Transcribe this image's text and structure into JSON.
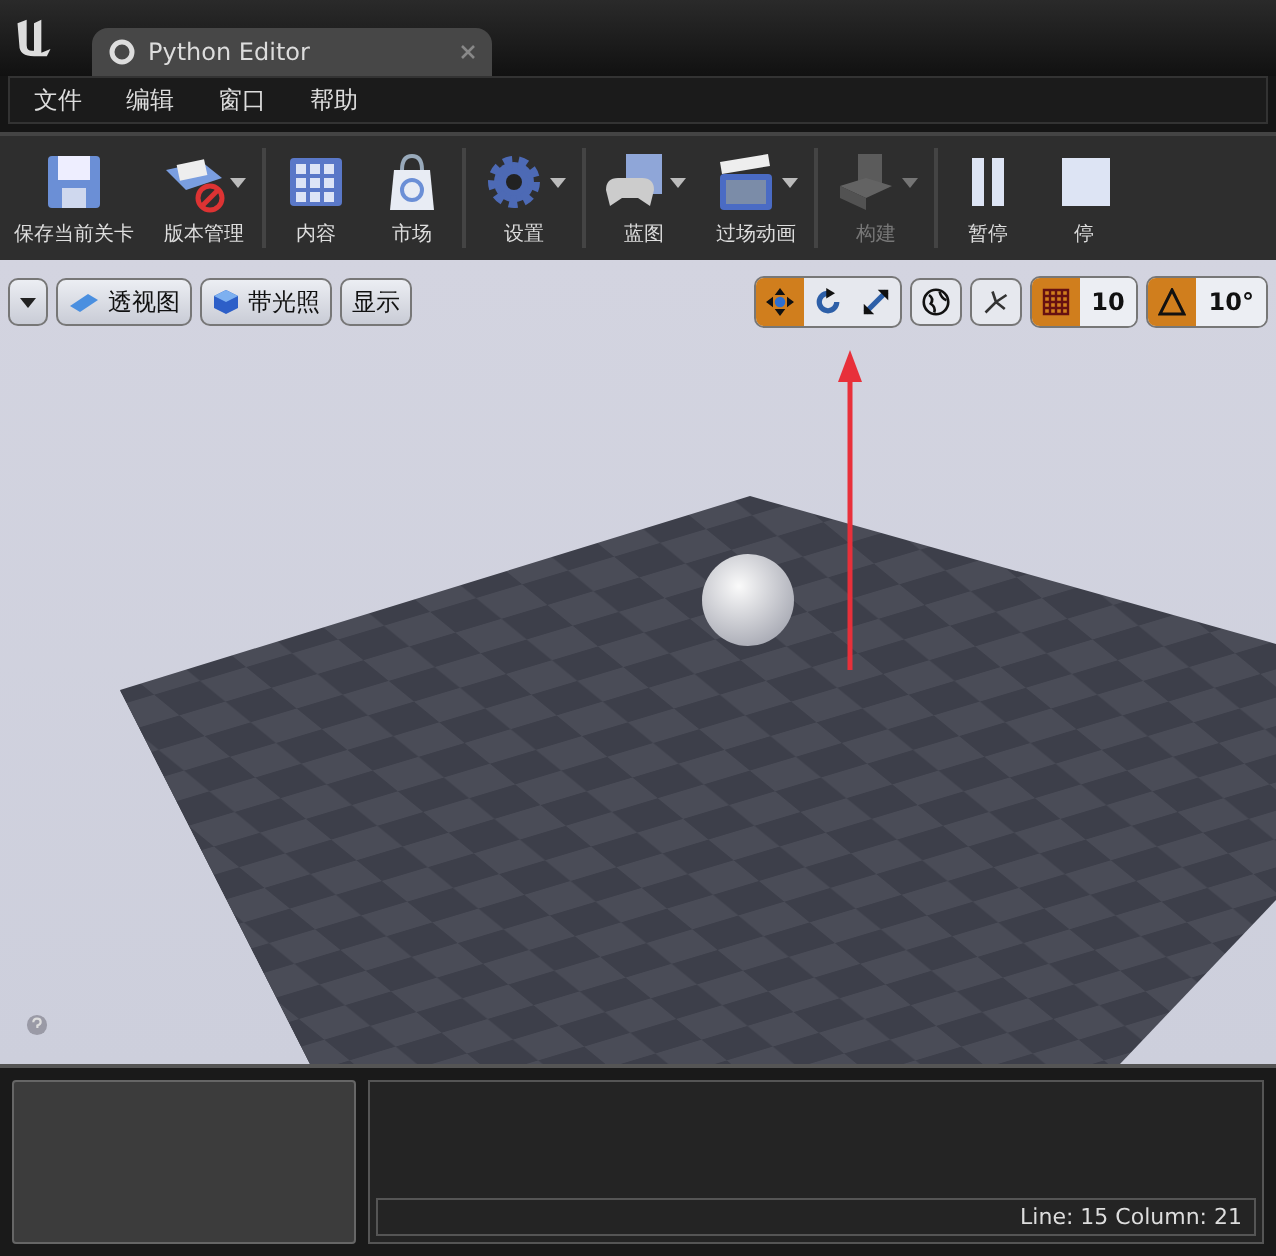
{
  "window": {
    "title": "Python Editor"
  },
  "menu": [
    "文件",
    "编辑",
    "窗口",
    "帮助"
  ],
  "toolbar_groups": [
    [
      {
        "kind": "save",
        "label": "保存当前关卡",
        "dropdown": false,
        "disabled": false
      },
      {
        "kind": "source",
        "label": "版本管理",
        "dropdown": true,
        "disabled": false
      }
    ],
    [
      {
        "kind": "content",
        "label": "内容",
        "dropdown": false,
        "disabled": false
      },
      {
        "kind": "market",
        "label": "市场",
        "dropdown": false,
        "disabled": false
      }
    ],
    [
      {
        "kind": "settings",
        "label": "设置",
        "dropdown": true,
        "disabled": false
      }
    ],
    [
      {
        "kind": "blueprint",
        "label": "蓝图",
        "dropdown": true,
        "disabled": false
      },
      {
        "kind": "cinematics",
        "label": "过场动画",
        "dropdown": true,
        "disabled": false
      }
    ],
    [
      {
        "kind": "build",
        "label": "构建",
        "dropdown": true,
        "disabled": true
      }
    ],
    [
      {
        "kind": "pause",
        "label": "暂停",
        "dropdown": false,
        "disabled": false
      },
      {
        "kind": "stop",
        "label": "停",
        "dropdown": false,
        "disabled": false
      }
    ]
  ],
  "viewport_toolbar": {
    "left": [
      {
        "kind": "perspective",
        "label": "透视图"
      },
      {
        "kind": "lit",
        "label": "带光照"
      },
      {
        "kind": "plain",
        "label": "显示"
      }
    ],
    "transform_tools": [
      {
        "kind": "move",
        "selected": true
      },
      {
        "kind": "rotate",
        "selected": false
      },
      {
        "kind": "scale",
        "selected": false
      }
    ],
    "snaps": [
      {
        "kind": "grid",
        "on": true,
        "value": "10"
      },
      {
        "kind": "rotation",
        "on": true,
        "value": "10°"
      }
    ]
  },
  "status_bar": {
    "position": "Line: 15 Column: 21"
  }
}
